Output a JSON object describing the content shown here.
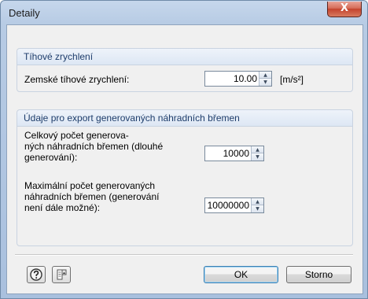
{
  "window": {
    "title": "Detaily",
    "close_glyph": "X"
  },
  "group1": {
    "title": "Tíhové zrychlení",
    "label": "Zemské tíhové zrychlení:",
    "value": "10.00",
    "unit": "[m/s²]"
  },
  "group2": {
    "title": "Údaje pro export generovaných náhradních břemen",
    "field1": {
      "label_lines": [
        "Celkový počet generova-",
        "ných náhradních břemen (dlouhé",
        "generování):"
      ],
      "value": "10000"
    },
    "field2": {
      "label_lines": [
        "Maximální počet generovaných",
        "náhradních břemen (generování",
        "není dále možné):"
      ],
      "value": "10000000"
    }
  },
  "footer": {
    "help_icon": "help-icon",
    "details_icon": "table-details-icon",
    "ok_label": "OK",
    "cancel_label": "Storno"
  }
}
